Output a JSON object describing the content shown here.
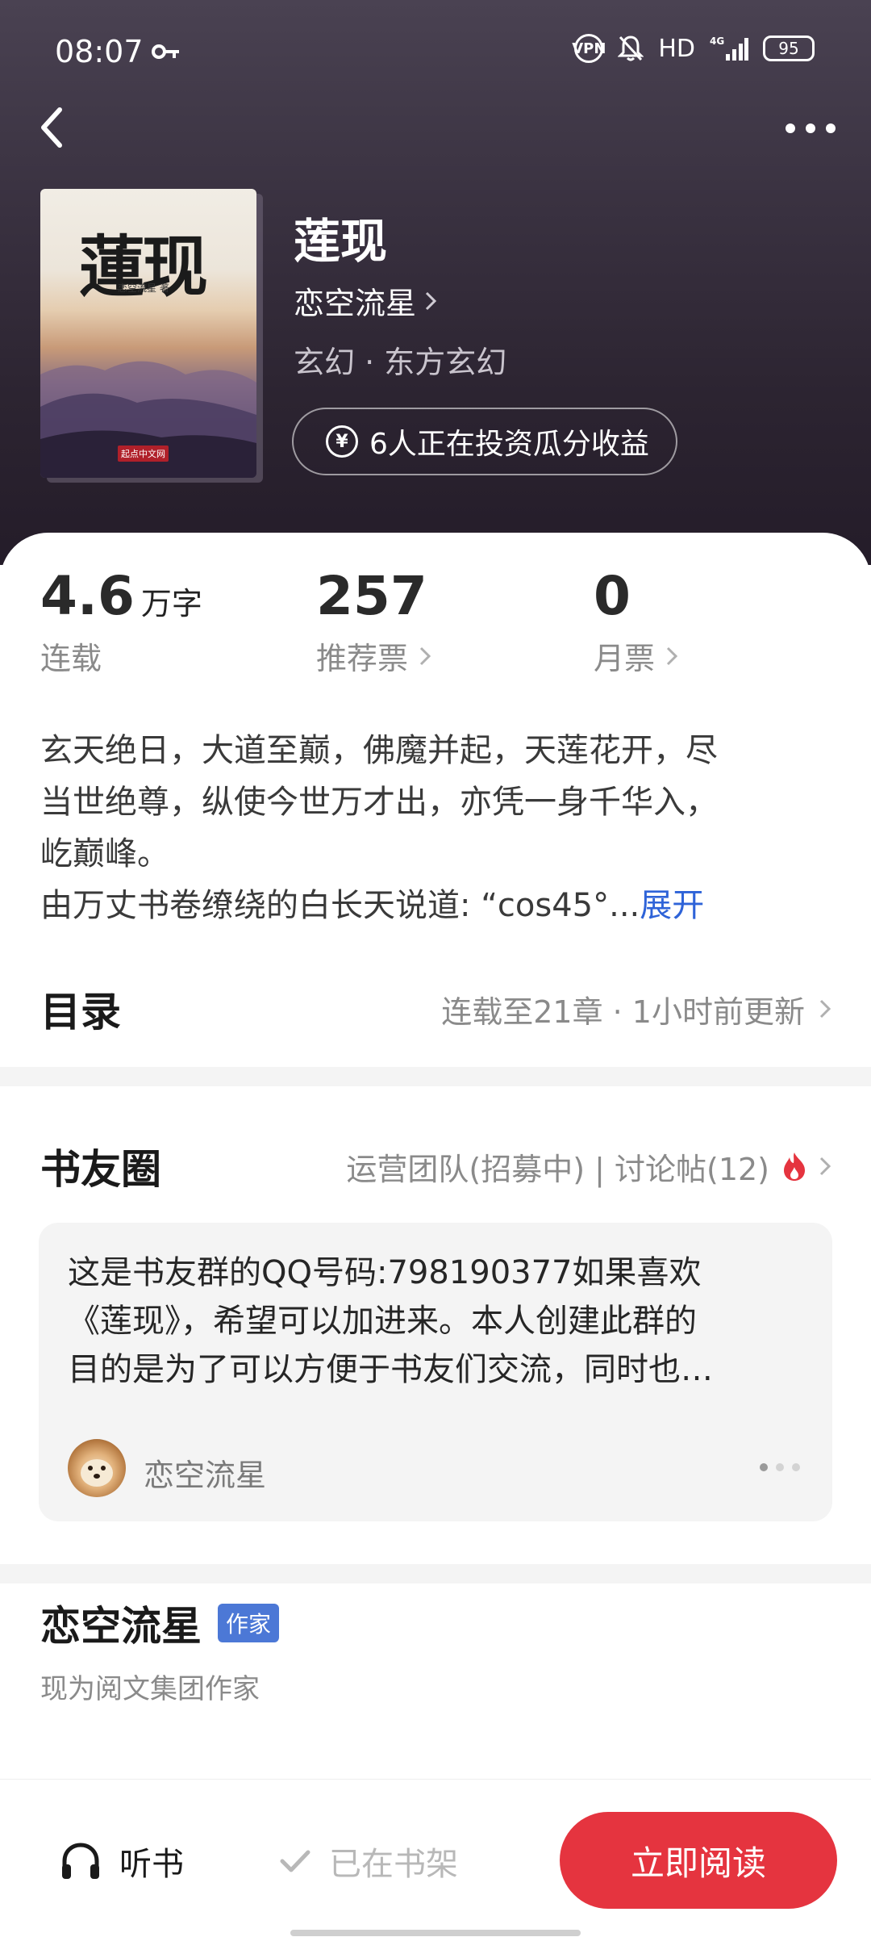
{
  "status_bar": {
    "time": "08:07",
    "vpn": "VPN",
    "hd": "HD",
    "network": "4G",
    "battery": "95"
  },
  "book": {
    "title": "莲现",
    "author": "恋空流星",
    "genre": "玄幻 · 东方玄幻",
    "invest_text": "6人正在投资瓜分收益",
    "cover": {
      "title": "蓮现",
      "author_line": "恋空流星 著",
      "publisher": "起点中文网"
    }
  },
  "stats": {
    "word_count_value": "4.6",
    "word_count_unit": "万字",
    "status": "连载",
    "recommend_value": "257",
    "recommend_label": "推荐票",
    "monthly_value": "0",
    "monthly_label": "月票"
  },
  "synopsis": {
    "line1": "玄天绝日，大道至巅，佛魔并起，天莲花开，尽",
    "line2": "当世绝尊，纵使今世万才出，亦凭一身千华入，",
    "line3": "屹巅峰。",
    "line4": "由万丈书卷缭绕的白长天说道: “cos45°...",
    "expand": "展开"
  },
  "toc": {
    "title": "目录",
    "meta": "连载至21章 · 1小时前更新"
  },
  "book_circle": {
    "title": "书友圈",
    "meta": "运营团队(招募中) | 讨论帖(12)",
    "post": {
      "line1": "这是书友群的QQ号码:798190377如果喜欢",
      "line2": "《莲现》，希望可以加进来。本人创建此群的",
      "line3": "目的是为了可以方便于书友们交流，同时也…",
      "author": "恋空流星"
    }
  },
  "author_section": {
    "name": "恋空流星",
    "badge": "作家",
    "desc": "现为阅文集团作家"
  },
  "bottom_bar": {
    "listen": "听书",
    "shelf": "已在书架",
    "read": "立即阅读"
  },
  "colors": {
    "accent_red": "#e5343f",
    "link_blue": "#2e63d8",
    "badge_blue": "#4c78d6"
  }
}
